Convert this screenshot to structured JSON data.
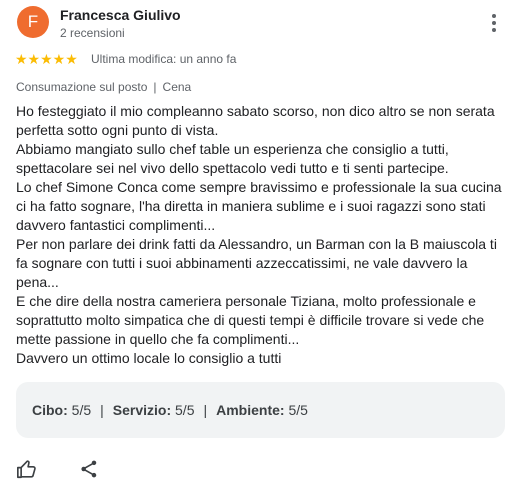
{
  "review": {
    "avatar_initial": "F",
    "avatar_color": "#ef6c2f",
    "author": "Francesca Giulivo",
    "reviews_count": "2 recensioni",
    "stars": "★★★★★",
    "rating_value": 5,
    "modified": "Ultima modifica: un anno fa",
    "meta": {
      "service": "Consumazione sul posto",
      "separator": "|",
      "meal": "Cena"
    },
    "paragraphs": [
      "Ho festeggiato il mio compleanno sabato scorso, non dico altro se non serata perfetta sotto ogni punto di vista.",
      "Abbiamo mangiato sullo chef table un esperienza che consiglio a tutti, spettacolare sei nel vivo dello spettacolo vedi tutto e ti senti partecipe.",
      "Lo chef Simone Conca come sempre bravissimo e professionale la sua cucina ci ha fatto sognare, l'ha diretta in maniera sublime e i suoi ragazzi sono stati davvero fantastici complimenti...",
      "Per non parlare dei drink fatti da Alessandro, un Barman con la B maiuscola ti fa sognare con tutti i suoi abbinamenti azzeccatissimi, ne vale davvero la pena...",
      "E che dire della nostra cameriera personale Tiziana, molto professionale e soprattutto molto simpatica che di questi tempi è difficile trovare si vede che mette passione in quello che fa complimenti...",
      "Davvero un ottimo locale lo consiglio a tutti"
    ],
    "ratings": {
      "food_label": "Cibo:",
      "food_value": "5/5",
      "service_label": "Servizio:",
      "service_value": "5/5",
      "ambience_label": "Ambiente:",
      "ambience_value": "5/5",
      "separator": "|"
    },
    "icons": {
      "menu": "more-vert-icon",
      "like": "thumbs-up-icon",
      "share": "share-icon"
    }
  }
}
